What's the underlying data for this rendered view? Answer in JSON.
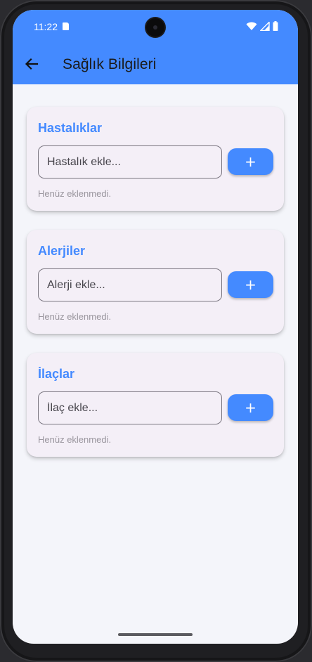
{
  "status_bar": {
    "time": "11:22",
    "icons": [
      "sd-card-icon",
      "wifi-icon",
      "signal-icon",
      "battery-icon"
    ]
  },
  "app_bar": {
    "back_icon": "arrow-left-icon",
    "title": "Sağlık Bilgileri",
    "color": "#448aff"
  },
  "sections": [
    {
      "title": "Hastalıklar",
      "placeholder": "Hastalık ekle...",
      "value": "",
      "add_label": "+",
      "empty_text": "Henüz eklenmedi."
    },
    {
      "title": "Alerjiler",
      "placeholder": "Alerji ekle...",
      "value": "",
      "add_label": "+",
      "empty_text": "Henüz eklenmedi."
    },
    {
      "title": "İlaçlar",
      "placeholder": "İlaç ekle...",
      "value": "",
      "add_label": "+",
      "empty_text": "Henüz eklenmedi."
    }
  ],
  "colors": {
    "accent": "#448aff",
    "card_bg": "#f4eff7",
    "page_bg": "#f4f5fa",
    "muted_text": "#9a969e"
  }
}
